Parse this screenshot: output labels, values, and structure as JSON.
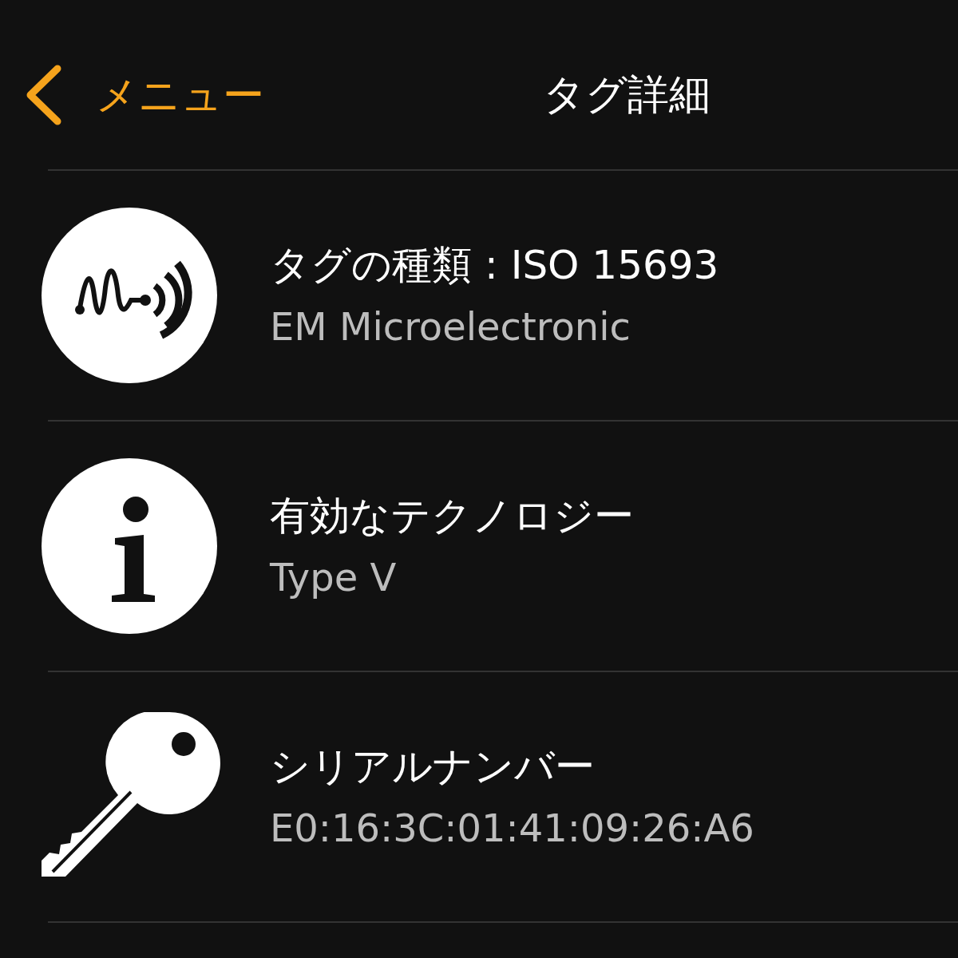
{
  "header": {
    "back_label": "メニュー",
    "title": "タグ詳細"
  },
  "rows": [
    {
      "kind": "signal",
      "title": "タグの種類 : ISO 15693",
      "value": "EM Microelectronic"
    },
    {
      "kind": "info",
      "title": "有効なテクノロジー",
      "value": "Type V"
    },
    {
      "kind": "key",
      "title": "シリアルナンバー",
      "value": "E0:16:3C:01:41:09:26:A6"
    }
  ]
}
